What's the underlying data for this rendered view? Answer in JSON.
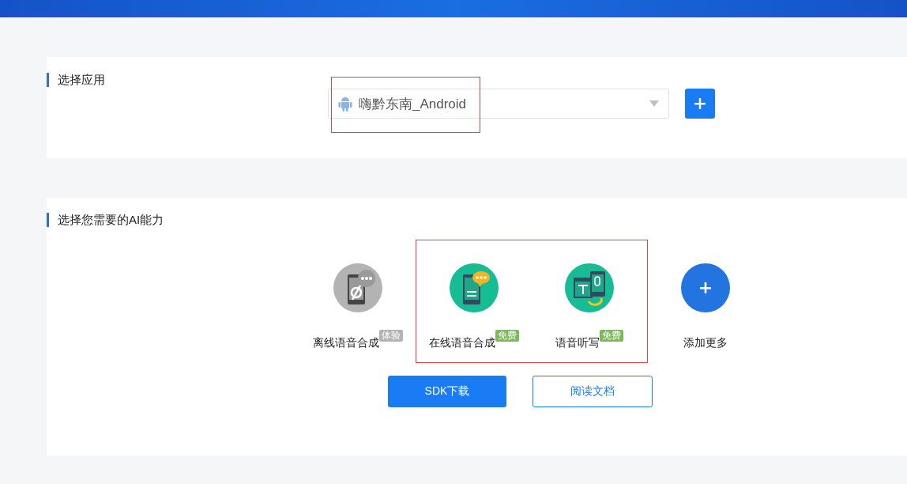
{
  "app_section": {
    "title": "选择应用",
    "select": {
      "value": "嗨黔东南_Android",
      "highlighted": true
    }
  },
  "ability_section": {
    "title": "选择您需要的AI能力",
    "abilities": [
      {
        "kind": "offline",
        "label": "离线语音合成",
        "tag": {
          "kind": "trial",
          "text": "体验"
        },
        "highlighted": false
      },
      {
        "kind": "online",
        "label": "在线语音合成",
        "tag": {
          "kind": "free",
          "text": "免费"
        },
        "highlighted": true
      },
      {
        "kind": "dictation",
        "label": "语音听写",
        "tag": {
          "kind": "free",
          "text": "免费"
        },
        "highlighted": true
      },
      {
        "kind": "add",
        "label": "添加更多",
        "highlighted": false
      }
    ],
    "buttons": [
      {
        "kind": "primary",
        "label": "SDK下载"
      },
      {
        "kind": "outline",
        "label": "阅读文档"
      }
    ]
  }
}
